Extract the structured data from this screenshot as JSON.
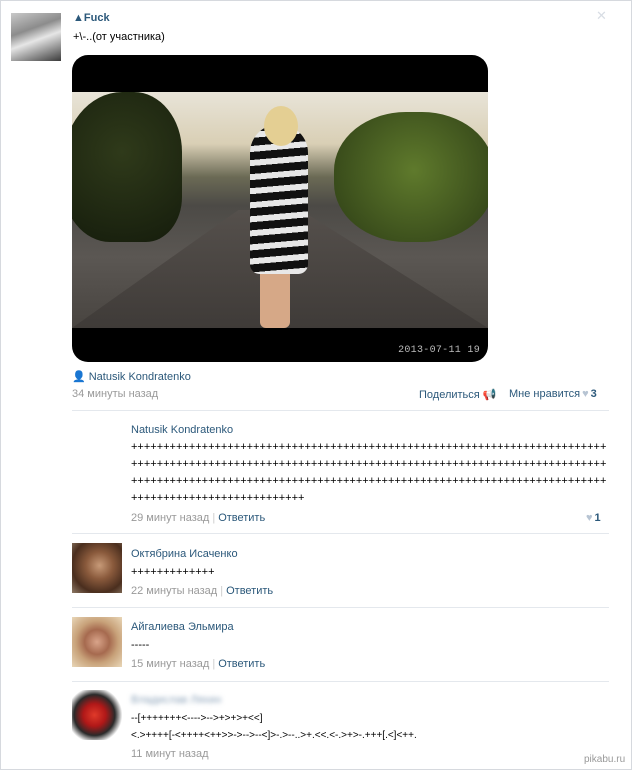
{
  "post": {
    "author": "▲Fuck",
    "text": "+\\-..(от участника)",
    "photo_date": "2013-07-11 19",
    "person": "Natusik Kondratenko",
    "time": "34 минуты назад",
    "share_label": "Поделиться",
    "like_label": "Мне нравится",
    "like_count": "3",
    "close_glyph": "✕"
  },
  "comments": [
    {
      "name": "Natusik Kondratenko",
      "text": "+++++++++++++++++++++++++++++++++++++++++++++++++++++++++++++++++++++++++++++++++++++++++++++++++++++++++++++++++++++++++++++++++++++++++++++++++++++++++++++++++++++++++++++++++++++++++++++++++++++++++++++++++++++++++++++++++++++++++++++++++++++++++",
      "time": "29 минут назад",
      "reply": "Ответить",
      "likes": "1"
    },
    {
      "name": "Октябрина Исаченко",
      "text": "+++++++++++++",
      "time": "22 минуты назад",
      "reply": "Ответить"
    },
    {
      "name": "Айгалиева Эльмира",
      "text": "-----",
      "time": "15 минут назад",
      "reply": "Ответить"
    },
    {
      "name": "Владислав Ляхин",
      "text": "--[+++++++<---->-->+>+>+<<]\n<.>++++[-<++++<++>>->-->--<]>-.>--..>+.<<.<-.>+>-.+++[.<]<++.",
      "time": "11 минут назад"
    }
  ],
  "watermark": "pikabu.ru",
  "colors": {
    "link": "#2b587a",
    "meta": "#999999",
    "divider": "#e4e8ed"
  }
}
